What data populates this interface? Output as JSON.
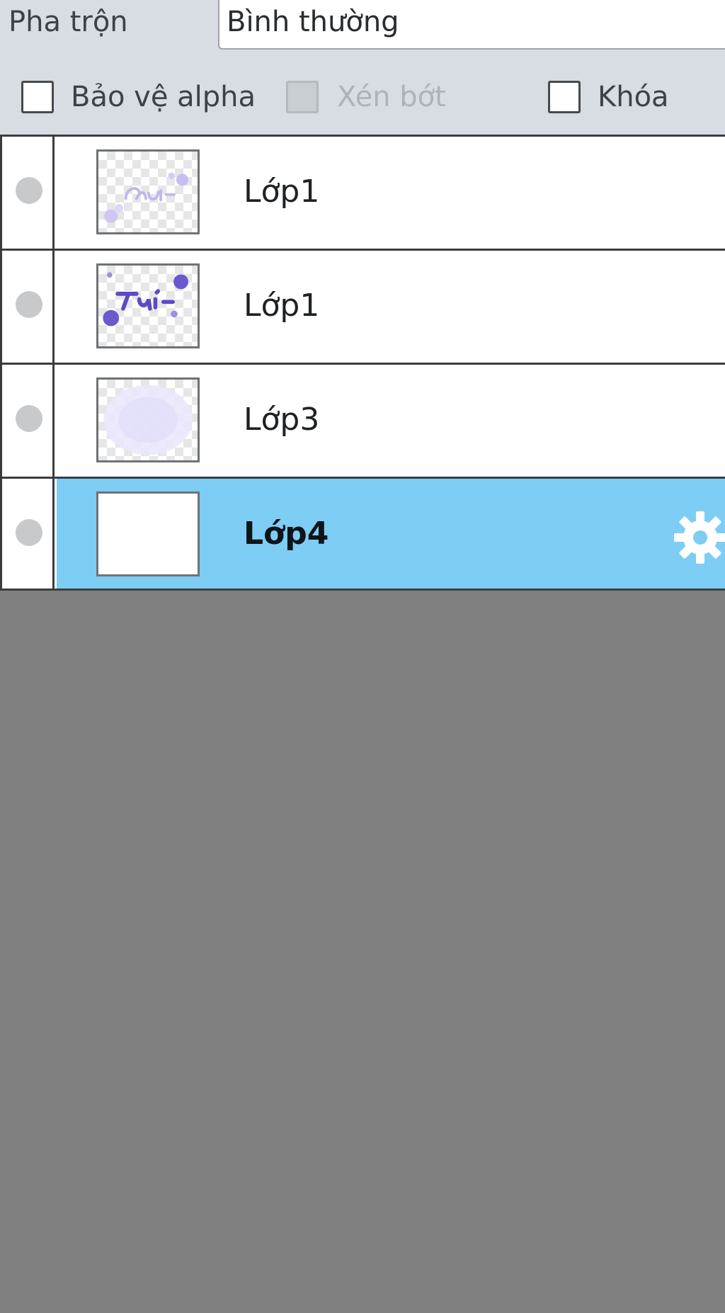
{
  "blend": {
    "label": "Pha trộn",
    "value": "Bình thường"
  },
  "options": {
    "protect_alpha": "Bảo vệ alpha",
    "clip": "Xén bớt",
    "lock": "Khóa"
  },
  "layers": [
    {
      "name": "Lớp1",
      "selected": false
    },
    {
      "name": "Lớp1",
      "selected": false
    },
    {
      "name": "Lớp3",
      "selected": false
    },
    {
      "name": "Lớp4",
      "selected": true
    }
  ],
  "colors": {
    "selected_row": "#7ecdf4",
    "panel_bg": "#d7dde2",
    "canvas_bg": "#808080",
    "thumb_ink": "#6a5acd"
  },
  "icons": {
    "visibility": "visibility-dot-icon",
    "layer_settings": "gear-icon"
  }
}
